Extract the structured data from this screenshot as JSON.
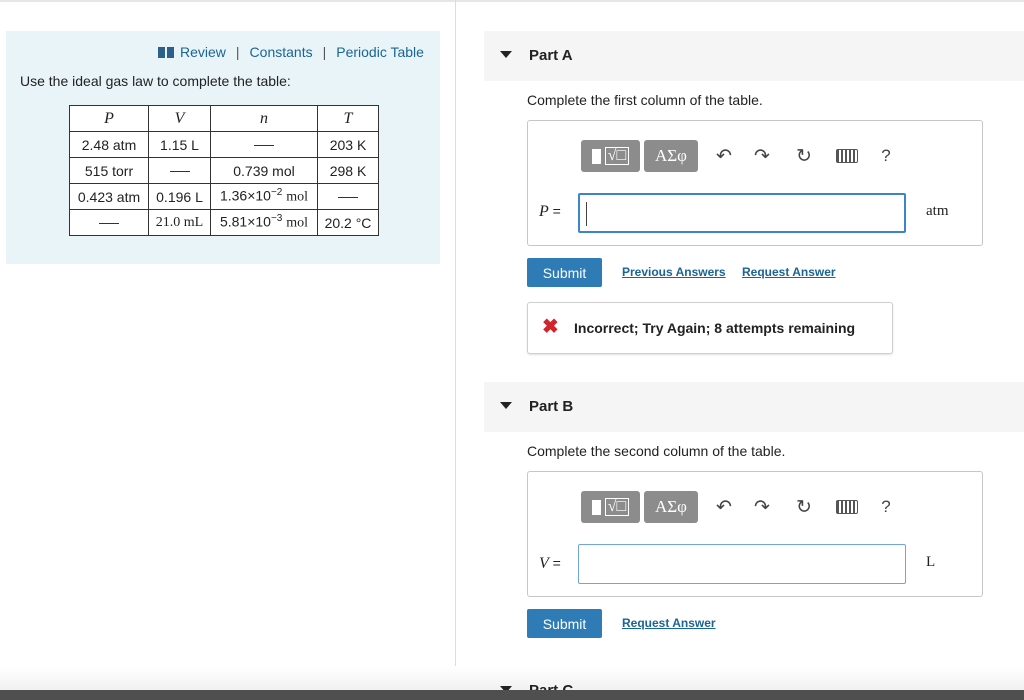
{
  "info": {
    "links": [
      "Review",
      "Constants",
      "Periodic Table"
    ],
    "separator": "|",
    "instruction": "Use the ideal gas law to complete the table:",
    "table": {
      "headers": [
        "P",
        "V",
        "n",
        "T"
      ],
      "rows": [
        [
          "2.48 atm",
          "1.15 L",
          "",
          "203 K"
        ],
        [
          "515 torr",
          "",
          "0.739 mol",
          "298 K"
        ],
        [
          "0.423 atm",
          "0.196 L",
          "1.36×10",
          "",
          "",
          "",
          ""
        ],
        [
          "",
          "21.0 mL",
          "5.81×10",
          "",
          "20.2 °C"
        ]
      ],
      "cells": {
        "r1": {
          "p": "2.48 atm",
          "v": "1.15 L",
          "t": "203 K"
        },
        "r2": {
          "p": "515 torr",
          "n": "0.739 mol",
          "t": "298 K"
        },
        "r3": {
          "p": "0.423 atm",
          "v": "0.196 L",
          "n_base": "1.36×10",
          "n_exp": "−2",
          "n_unit": "mol"
        },
        "r4": {
          "v": "21.0 mL",
          "n_base": "5.81×10",
          "n_exp": "−3",
          "n_unit": "mol",
          "t": "20.2 °C"
        }
      }
    }
  },
  "toolbar": {
    "greek_label": "ΑΣφ",
    "templates_root": "√□",
    "undo_icon": "↶",
    "redo_icon": "↷",
    "reset_icon": "↻",
    "help_label": "?"
  },
  "part_a": {
    "title": "Part A",
    "prompt": "Complete the first column of the table.",
    "variable": "P",
    "equals": "=",
    "input_value": "",
    "unit": "atm",
    "submit_label": "Submit",
    "previous_answers_label": "Previous Answers",
    "request_answer_label": "Request Answer",
    "feedback_icon": "✖",
    "feedback_text": "Incorrect; Try Again; 8 attempts remaining"
  },
  "part_b": {
    "title": "Part B",
    "prompt": "Complete the second column of the table.",
    "variable": "V",
    "equals": "=",
    "input_value": "",
    "unit": "L",
    "submit_label": "Submit",
    "request_answer_label": "Request Answer"
  },
  "part_c": {
    "title": "Part C"
  },
  "colors": {
    "accent": "#2e7bb5",
    "link": "#1a6496",
    "panel_bg": "#e9f4f8",
    "error": "#d1242b"
  }
}
